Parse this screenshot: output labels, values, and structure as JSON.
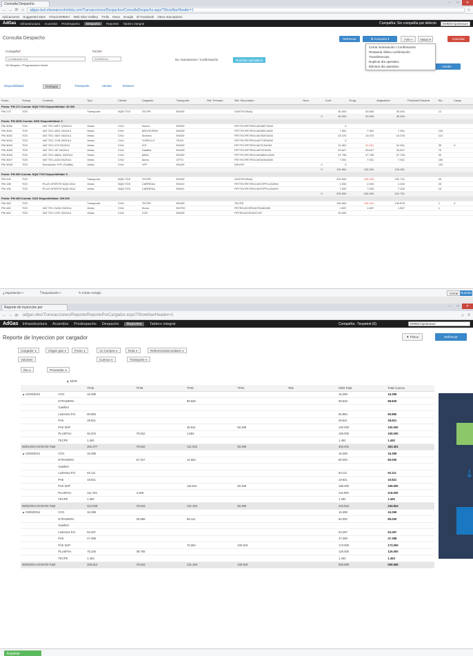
{
  "w1": {
    "tab_title": "Consulta Despacho",
    "url": "adgas-test.elsewarecolombia.com/Transacciones/Despachos/ConsultaDespacho.aspx?ShowNavHeader=1",
    "bookmarks": [
      "Aplicaciones",
      "Suggested Sites",
      "Virtual EMMSA",
      "Web Slice Gallery",
      "Trello",
      "Deva",
      "Google",
      "El Facebook",
      "Otros marcadores"
    ],
    "brand": "AdGas",
    "nav": [
      "Infraestructura",
      "Acuerdos",
      "Predespacho",
      "Despacho",
      "Reportes",
      "Tablero integral"
    ],
    "nav_selected": "Despacho",
    "company_label": "Compañía: Sin compañía por defecto",
    "user": "EMMSA\\peterauer",
    "page_title": "Consulta Despacho",
    "btn_refresh": "Refrescar",
    "btn_actions": "Acciones",
    "btn_ver": "Ver",
    "btn_vistas": "Vistas",
    "btn_cancel": "Cancelar",
    "btn_right": "cender",
    "menu": [
      "Cerrar Nominación / Confirmación",
      "Restaurar último confirmación",
      "Transferencias",
      "Duplicar día operativo",
      "Eliminar día operativo"
    ],
    "lbl_compania": "Compañía",
    "lbl_fecha": "Fecha",
    "val_compania": "La Imbutera S.A.",
    "val_fecha": "01/09/2014",
    "note": "Sin Bloqueo / Programación Inicial",
    "lbl_nom": "No. Nominación / Confirmación",
    "chip_nom": "Nominar operativos",
    "subtabs": [
      "Disponibilidad",
      "Entregas",
      "Transporte",
      "Ventas",
      "Enlaces"
    ],
    "subtab_active": "Entregas",
    "columns": [
      "Punto",
      "Transp.",
      "Contrato",
      "Tipo",
      "Cliente",
      "Cargador",
      "Transporte",
      "Ref. Primario",
      "Ref. Secundario",
      "Nom.",
      "Conf.",
      "Progr.",
      "Asignación",
      "Prioridad Primaria",
      "Ktz",
      "Cargo"
    ],
    "rows": [
      {
        "g": "Punto: PM 272 Cuenta: NQN TGS    Disponibilidad: 30.000"
      },
      {
        "c": [
          "PM 272",
          "TGS",
          "",
          "Transporte",
          "NQN TGS",
          "TECPE",
          "ENGIE",
          "",
          "GASTECINAQ",
          "",
          "30.000",
          "30.000",
          "30.304",
          "",
          "12",
          ""
        ]
      },
      {
        "t": [
          "",
          "",
          "",
          "",
          "",
          "",
          "",
          "",
          "",
          "0",
          "30.000",
          "30.000",
          "30.304",
          "",
          "",
          ""
        ]
      },
      {
        "g": "Punto: PM 3000 Cuenta: DNS    Disponibilidad: 0"
      },
      {
        "c": [
          "PM 3000",
          "TGS",
          "VAT TEC-MET Q3/2014",
          "Venta",
          "CHU",
          "Nuevo",
          "ENGIE",
          "",
          "PETTECPETROLVATMET4000",
          "",
          "0",
          "",
          "",
          "",
          "",
          ""
        ]
      },
      {
        "c": [
          "PM 3001",
          "TGS",
          "VAT TEC-ARC 03/2014",
          "Venta",
          "CHU",
          "ARCHIVERA",
          "ENGIE",
          "",
          "PETTECPETROLVATARC4000",
          "",
          "7.951",
          "7.951",
          "7.951",
          "",
          "120",
          ""
        ]
      },
      {
        "c": [
          "PM 3002",
          "TGS",
          "VAT TEC-SMT 03/2014",
          "Venta",
          "CHU",
          "Somera",
          "ENGIE",
          "",
          "PETTECPETROLVATSMT4000",
          "",
          "10.076",
          "10.076",
          "10.076",
          "",
          "110",
          ""
        ]
      },
      {
        "c": [
          "PM 3003",
          "TGS",
          "VAT TEC-TOR 03/2014",
          "Venta",
          "CHU",
          "TORELLO",
          "TEXO",
          "",
          "PETTECPETROLVATTOR4000",
          "",
          "0",
          "",
          "",
          "",
          "",
          ""
        ]
      },
      {
        "c": [
          "PM 3004",
          "TGS",
          "VAT TEC-ICS 03/2014",
          "Venta",
          "CHU",
          "ICS",
          "ENGIE",
          "",
          "PETTECPETROLVATICS4000",
          "",
          "31.561",
          "31.061",
          "31.061",
          "",
          "30",
          "X"
        ],
        "red": 11
      },
      {
        "c": [
          "PM 3005",
          "TGS",
          "VAT TEC-GF 03/2014",
          "Venta",
          "CHU",
          "Gasfiter",
          "ENGIE",
          "",
          "PETTECPETROLVATGF4000",
          "",
          "29.627",
          "29.627",
          "29.627",
          "",
          "70",
          ""
        ]
      },
      {
        "c": [
          "PM 3006",
          "TGS",
          "VAT TEC-ABGL 03/2014",
          "Venta",
          "CHU",
          "ABGL",
          "ENGIE",
          "",
          "PETTECPETROLVATABGL4000",
          "",
          "37.755",
          "37.755",
          "37.755",
          "",
          "30",
          ""
        ]
      },
      {
        "c": [
          "PM 3007",
          "TGS",
          "VAT TEC-AGN 03/2014",
          "Venta",
          "CHU",
          "Acero",
          "CFTO",
          "",
          "PETTECPETROLVATAGN4000",
          "",
          "7.931",
          "7.931",
          "7.931",
          "",
          "150",
          ""
        ]
      },
      {
        "c": [
          "PM 3008",
          "TGS",
          "Devolución YPF (TecBlk)",
          "Venta",
          "CHU",
          "YPF",
          "ENGIE",
          "",
          "DEVOR",
          "0",
          "0",
          "",
          "",
          "",
          "120",
          ""
        ]
      },
      {
        "t": [
          "",
          "",
          "",
          "",
          "",
          "",
          "",
          "",
          "",
          "0",
          "120.951",
          "120.251",
          "120.251",
          "",
          "",
          ""
        ]
      },
      {
        "g": "Punto: PM 300 Cuenta: NQN TGS    Disponibilidad: 0"
      },
      {
        "c": [
          "PM 200",
          "TGS",
          "",
          "Transporte",
          "NQN TGS",
          "TECPE",
          "ENGIE",
          "",
          "GASTECINAQ",
          "",
          "220.000",
          "240.000",
          "231.731",
          "",
          "20",
          ""
        ],
        "red": 11
      },
      {
        "c": [
          "PM 198",
          "TGS",
          "PLUS OFERTE NQN 2014",
          "Venta",
          "NQN TGS",
          "CARRIDIA",
          "ENGI2",
          "",
          "PETTECPETROLVATOPPLUS2000",
          "",
          "1.000",
          "2.000",
          "1.000",
          "",
          "20",
          ""
        ]
      },
      {
        "c": [
          "PM 199",
          "TGS",
          "PLUS OFERTE NQN 2014",
          "Venta",
          "NQN TGS",
          "CARRIDIA",
          "ENGI2",
          "",
          "PETTECPETROLVATOPPLUS4000",
          "",
          "7.000",
          "7.000",
          "7.000",
          "",
          "10",
          ""
        ]
      },
      {
        "t": [
          "",
          "",
          "",
          "",
          "",
          "",
          "",
          "",
          "",
          "0",
          "230.000",
          "240.000",
          "241.731",
          "",
          "",
          ""
        ]
      },
      {
        "g": "Punto: PM 465 Cuenta: GAS    Disponibilidad: 200.000"
      },
      {
        "c": [
          "PM 460",
          "TGS",
          "",
          "Transporte",
          "CHU",
          "TECPE",
          "ENGIE",
          "",
          "TECPE",
          "",
          "149.062",
          "140.242",
          "139.875",
          "",
          "1",
          "X"
        ],
        "red": 11
      },
      {
        "c": [
          "PM 460",
          "TGS",
          "VAT TEC-SUM 03/2014",
          "Venta",
          "CHU",
          "Somo",
          "ENTR2",
          "",
          "PETROLEORSVATSUM4000",
          "",
          "1.837",
          "1.837",
          "1.837",
          "",
          "1",
          ""
        ]
      },
      {
        "c": [
          "PM 462",
          "TGS",
          "VAT TEC-COF 03/2014",
          "Venta",
          "CHU",
          "COF",
          "ENGIE",
          "",
          "PETROLEOSVATCOF",
          "",
          "20.000",
          "",
          "",
          "",
          "",
          ""
        ]
      }
    ],
    "footer_import": "Importación",
    "footer_export": "Exportación",
    "footer_iniciar": "Iniciar Arreglo",
    "footer_cerrar": "Cerrar",
    "footer_guardar": "Guardar"
  },
  "w2": {
    "tab_title": "Reporte de Inyeccion por",
    "url": "adgas-dev/Transacciones/Reporte/ReportePorCargador.aspx?ShowNavHeader=1",
    "brand": "AdGas",
    "nav": [
      "Infraestructura",
      "Acuerdos",
      "Predespacho",
      "Despacho",
      "Reportes",
      "Tablero integral"
    ],
    "nav_selected": "Reportes",
    "company_label": "Compañía : Tecpetrol (0)",
    "user": "EMMSA\\peterauer",
    "page_title": "Reporte de Inyeccion por cargador",
    "btn_filtros": "Filtros",
    "btn_refresh": "Refrescar",
    "chips_row1": [
      "Cargador",
      "Origen gas",
      "Punto",
      "Ac.Compra",
      "Ruta",
      "ReferenciaSecundario"
    ],
    "chip_volumen": "Volumen",
    "chips_row2": [
      "Cuenca",
      "Transporte"
    ],
    "chip_dia": "Dia",
    "chip_proveedor": "Proveedor",
    "nor_label": "▲ NOR",
    "cols": [
      "TF25",
      "TF26",
      "TF35",
      "TF94",
      "TD8"
    ],
    "col_nor_total": "NOR Total",
    "col_total_cuenca": "Total Cuenca",
    "rows": [
      {
        "c": [
          "▲ 01/06/2014",
          "COC",
          "16.399",
          "",
          "",
          "",
          "",
          "16.399",
          "16.399"
        ]
      },
      {
        "c": [
          "",
          "ETRADERS",
          "",
          "",
          "89.829",
          "",
          "",
          "89.829",
          "89.829"
        ]
      },
      {
        "c": [
          "",
          "Gasified",
          "",
          "",
          "",
          "",
          "",
          "",
          ""
        ]
      },
      {
        "c": [
          "",
          "Ledesma Pol",
          "60.860",
          "",
          "",
          "",
          "",
          "60.860",
          "60.860"
        ]
      },
      {
        "c": [
          "",
          "PAE",
          "28.821",
          "",
          "",
          "",
          "",
          "28.821",
          "28.821"
        ]
      },
      {
        "c": [
          "",
          "PAE SHP",
          "",
          "",
          "49.541",
          "50.459",
          "",
          "100.000",
          "100.000"
        ]
      },
      {
        "c": [
          "",
          "PLUSPSA",
          "92.204",
          "70.842",
          "1.653",
          "",
          "",
          "165.000",
          "165.000"
        ]
      },
      {
        "c": [
          "",
          "TECPE",
          "1.492",
          "",
          "",
          "",
          "",
          "1.492",
          "1.492"
        ]
      },
      {
        "t": [
          "06/01/2014 00:00:00 Total",
          "",
          "281.277",
          "70.842",
          "141.022",
          "50.459",
          "",
          "463.401",
          "463.401"
        ]
      },
      {
        "c": [
          "▲ 02/06/2014",
          "COC",
          "16.399",
          "",
          "",
          "",
          "",
          "16.399",
          "16.399"
        ]
      },
      {
        "c": [
          "",
          "ETRADERS",
          "",
          "67.347",
          "12.653",
          "",
          "",
          "80.000",
          "80.000"
        ]
      },
      {
        "c": [
          "",
          "Gasified",
          "",
          "",
          "",
          "",
          "",
          "",
          ""
        ]
      },
      {
        "c": [
          "",
          "Ledesma Pol",
          "63.111",
          "",
          "",
          "",
          "",
          "63.111",
          "63.111"
        ]
      },
      {
        "c": [
          "",
          "PAE",
          "19.821",
          "",
          "",
          "",
          "",
          "19.821",
          "19.821"
        ]
      },
      {
        "c": [
          "",
          "PAE SHP",
          "",
          "",
          "118.541",
          "50.459",
          "",
          "169.000",
          "169.000"
        ]
      },
      {
        "c": [
          "",
          "PLUSPSA",
          "111.704",
          "3.296",
          "",
          "",
          "",
          "115.000",
          "115.000"
        ]
      },
      {
        "c": [
          "",
          "TECPE",
          "1.492",
          "",
          "",
          "",
          "",
          "1.492",
          "1.492"
        ]
      },
      {
        "t": [
          "06/02/2014 00:00:00 Total",
          "",
          "212.528",
          "70.643",
          "131.194",
          "50.459",
          "",
          "434.824",
          "434.824"
        ]
      },
      {
        "c": [
          "▲ 03/06/2014",
          "COC",
          "16.399",
          "",
          "",
          "",
          "",
          "16.399",
          "16.399"
        ]
      },
      {
        "c": [
          "",
          "ETRADERS",
          "",
          "20.888",
          "59.112",
          "",
          "",
          "80.000",
          "80.000"
        ]
      },
      {
        "c": [
          "",
          "Gasified",
          "",
          "",
          "",
          "",
          "",
          "",
          ""
        ]
      },
      {
        "c": [
          "",
          "Ledesma Pol",
          "63.297",
          "",
          "",
          "",
          "",
          "63.297",
          "63.297"
        ]
      },
      {
        "c": [
          "",
          "PAE",
          "47.388",
          "",
          "",
          "",
          "",
          "47.388",
          "47.388"
        ]
      },
      {
        "c": [
          "",
          "PAE SHP",
          "",
          "",
          "72.082",
          "100.918",
          "",
          "173.000",
          "173.000"
        ]
      },
      {
        "c": [
          "",
          "PLUSPSA",
          "75.245",
          "49.755",
          "",
          "",
          "",
          "125.000",
          "125.000"
        ]
      },
      {
        "c": [
          "",
          "TECPE",
          "1.463",
          "",
          "",
          "",
          "",
          "1.463",
          "1.463"
        ]
      },
      {
        "t": [
          "06/03/2014 00:00:00 Total",
          "",
          "203.814",
          "70.643",
          "131.194",
          "100.918",
          "",
          "506.569",
          "506.569"
        ]
      }
    ],
    "export_label": "Exportar"
  }
}
